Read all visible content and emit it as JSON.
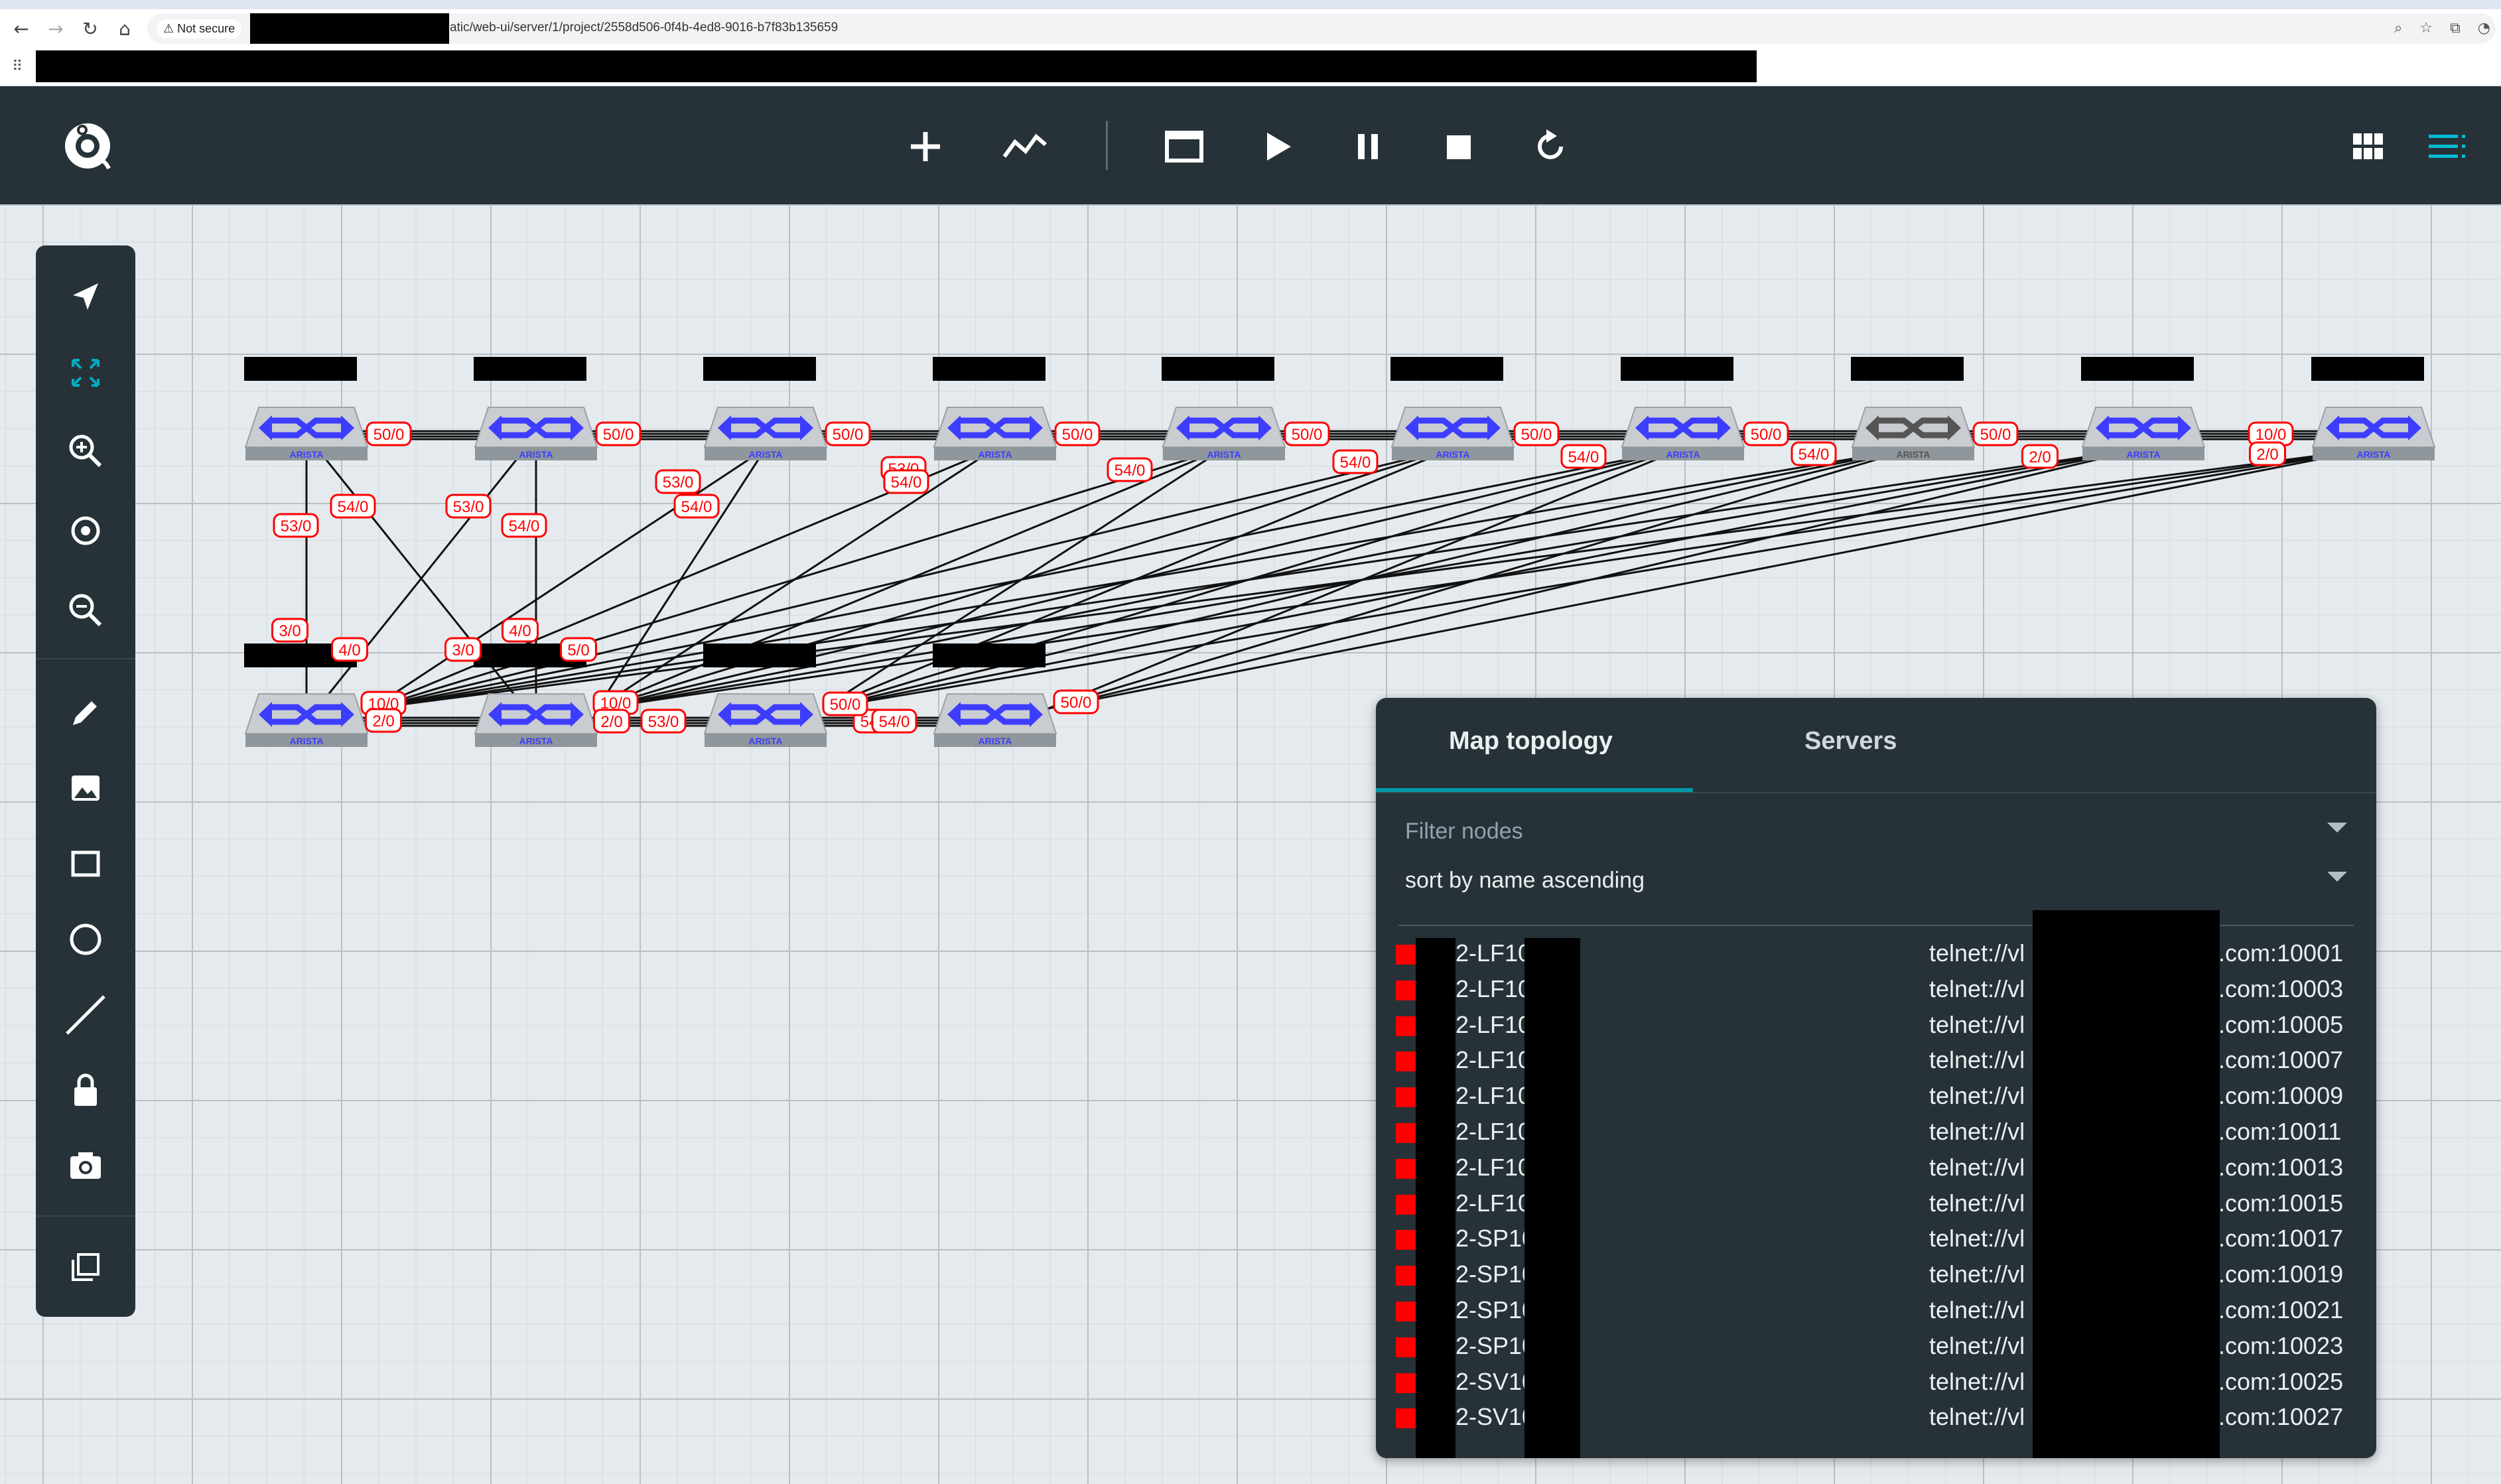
{
  "browser": {
    "back_icon": "back-arrow-icon",
    "forward_icon": "forward-arrow-icon",
    "reload_icon": "reload-icon",
    "home_icon": "home-icon",
    "security_label": "Not secure",
    "url_visible": "atic/web-ui/server/1/project/2558d506-0f4b-4ed8-9016-b7f83b135659"
  },
  "toolbar": {
    "logo_icon": "gns3-chameleon-logo",
    "buttons": [
      "add-node-icon",
      "draw-link-icon",
      "console-icon",
      "start-icon",
      "suspend-icon",
      "stop-icon",
      "reload-icon"
    ],
    "right_buttons": [
      "grid-view-icon",
      "menu-icon"
    ],
    "accent": "#00bcd4"
  },
  "tools": [
    "pointer-icon",
    "fit-to-screen-icon",
    "zoom-in-icon",
    "reset-zoom-icon",
    "zoom-out-icon",
    "edit-icon",
    "image-icon",
    "rectangle-icon",
    "ellipse-icon",
    "line-icon",
    "lock-icon",
    "screenshot-icon",
    "layers-icon"
  ],
  "topology": {
    "brand_label": "ARISTA",
    "link_color": "#ff0000",
    "link_labels_top": [
      "50/0",
      "50/0",
      "50/0",
      "50/0",
      "50/0",
      "50/0",
      "50/0",
      "50/0",
      "10/0",
      "2/0",
      "2/0"
    ],
    "link_labels_mid": [
      "54/0",
      "53/0",
      "53/0",
      "54/0",
      "53/0",
      "54/0",
      "53/0",
      "54/0",
      "54/0",
      "54/0",
      "54/0",
      "54/0",
      "54/0"
    ],
    "link_labels_bottom": [
      "3/0",
      "4/0",
      "3/0",
      "4/0",
      "5/0",
      "10/0",
      "2/0",
      "10/0",
      "2/0",
      "53/0",
      "50/0",
      "54/0",
      "50/0"
    ]
  },
  "panel": {
    "tabs": [
      "Map topology",
      "Servers"
    ],
    "filter_placeholder": "Filter nodes",
    "sort_value": "sort by name ascending",
    "nodes": [
      {
        "name": "2-LF10",
        "console_prefix": "telnet://vl",
        "console_suffix": ".com:10001"
      },
      {
        "name": "2-LF10",
        "console_prefix": "telnet://vl",
        "console_suffix": ".com:10003"
      },
      {
        "name": "2-LF10",
        "console_prefix": "telnet://vl",
        "console_suffix": ".com:10005"
      },
      {
        "name": "2-LF10",
        "console_prefix": "telnet://vl",
        "console_suffix": ".com:10007"
      },
      {
        "name": "2-LF10",
        "console_prefix": "telnet://vl",
        "console_suffix": ".com:10009"
      },
      {
        "name": "2-LF10",
        "console_prefix": "telnet://vl",
        "console_suffix": ".com:10011"
      },
      {
        "name": "2-LF10",
        "console_prefix": "telnet://vl",
        "console_suffix": ".com:10013"
      },
      {
        "name": "2-LF10",
        "console_prefix": "telnet://vl",
        "console_suffix": ".com:10015"
      },
      {
        "name": "2-SP10",
        "console_prefix": "telnet://vl",
        "console_suffix": ".com:10017"
      },
      {
        "name": "2-SP10",
        "console_prefix": "telnet://vl",
        "console_suffix": ".com:10019"
      },
      {
        "name": "2-SP10",
        "console_prefix": "telnet://vl",
        "console_suffix": ".com:10021"
      },
      {
        "name": "2-SP10",
        "console_prefix": "telnet://vl",
        "console_suffix": ".com:10023"
      },
      {
        "name": "2-SV10",
        "console_prefix": "telnet://vl",
        "console_suffix": ".com:10025"
      },
      {
        "name": "2-SV10",
        "console_prefix": "telnet://vl",
        "console_suffix": ".com:10027"
      }
    ],
    "status_color": "#ff0000"
  }
}
